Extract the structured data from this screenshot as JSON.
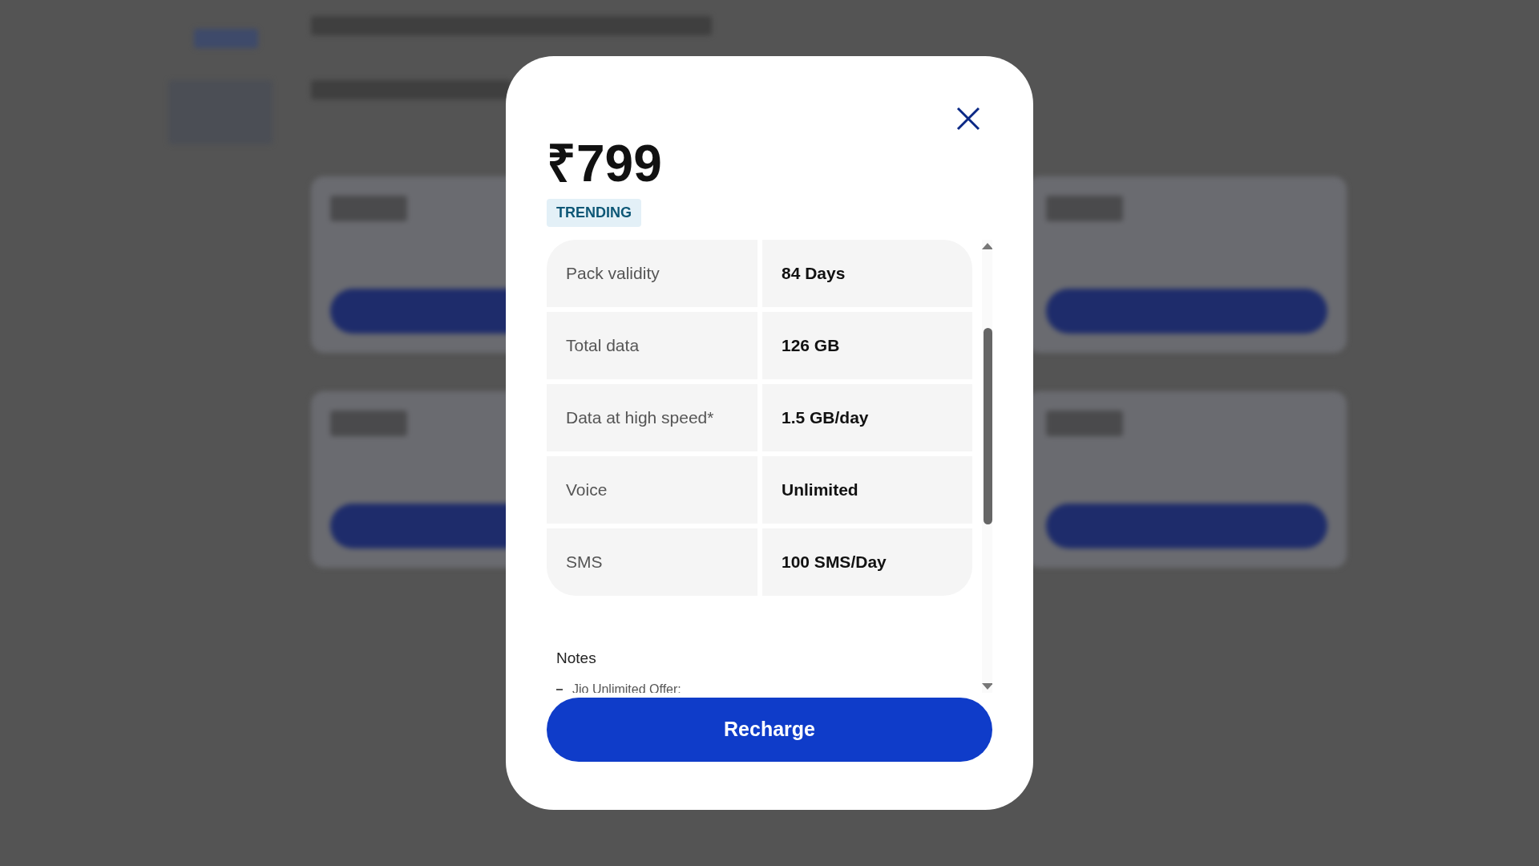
{
  "plan": {
    "price": "₹799",
    "badge": "TRENDING",
    "details": [
      {
        "label": "Pack validity",
        "value": "84 Days"
      },
      {
        "label": "Total data",
        "value": "126 GB"
      },
      {
        "label": "Data at high speed*",
        "value": "1.5 GB/day"
      },
      {
        "label": "Voice",
        "value": "Unlimited"
      },
      {
        "label": "SMS",
        "value": "100 SMS/Day"
      }
    ],
    "notes_title": "Notes",
    "notes": [
      "Jio Unlimited Offer:"
    ],
    "action": "Recharge"
  }
}
